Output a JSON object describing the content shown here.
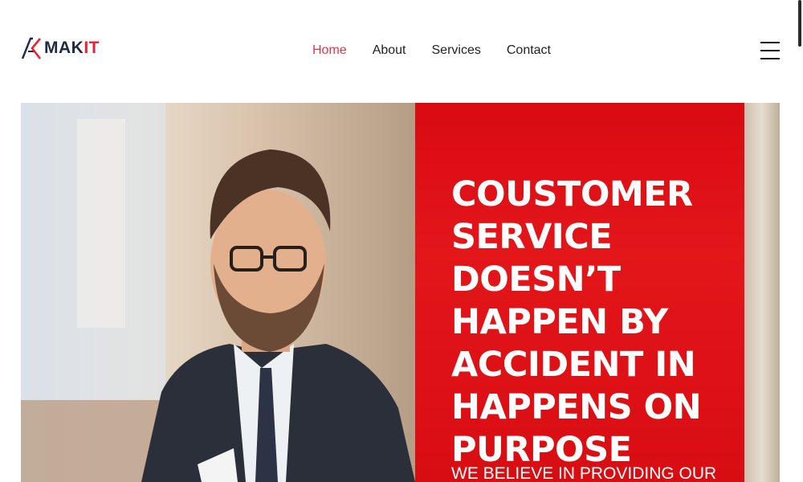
{
  "brand": {
    "name_part1": "MAK",
    "name_part2": "IT",
    "icon": "ak-logo-icon"
  },
  "nav": {
    "items": [
      {
        "label": "Home",
        "active": true
      },
      {
        "label": "About",
        "active": false
      },
      {
        "label": "Services",
        "active": false
      },
      {
        "label": "Contact",
        "active": false
      }
    ],
    "menu_icon": "hamburger-menu-icon"
  },
  "hero": {
    "image": "businessman-portrait-image",
    "headline": "COUSTOMER SERVICE DOESN’T HAPPEN BY ACCIDENT IN HAPPENS ON PURPOSE",
    "subheadline": "WE BELIEVE IN PROVIDING OUR"
  },
  "colors": {
    "accent_red": "#e8232f",
    "nav_active": "#e8334a",
    "brand_dark": "#1f2a44",
    "panel_red": "#e3161a"
  }
}
